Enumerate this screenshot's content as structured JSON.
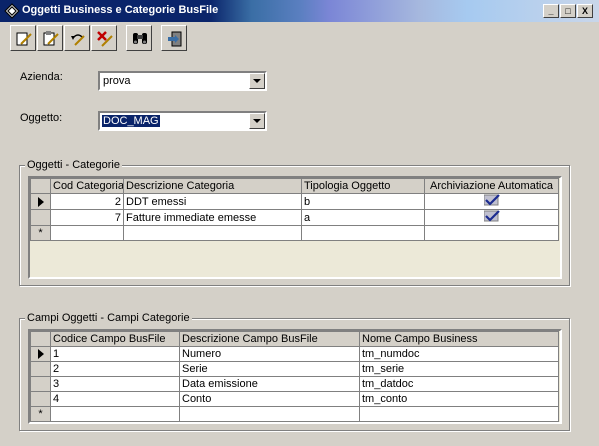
{
  "window": {
    "title": "Oggetti Business e Categorie BusFile",
    "min_label": "_",
    "max_label": "□",
    "close_label": "X"
  },
  "toolbar": {
    "buttons": [
      "new-icon",
      "edit-icon",
      "undo-icon",
      "delete-icon",
      "find-icon",
      "exit-icon"
    ]
  },
  "form": {
    "azienda_label": "Azienda:",
    "azienda_value": "prova",
    "oggetto_label": "Oggetto:",
    "oggetto_value": "DOC_MAG"
  },
  "categorie": {
    "legend": "Oggetti - Categorie",
    "columns": [
      "Cod Categoria",
      "Descrizione Categoria",
      "Tipologia Oggetto",
      "Archiviazione Automatica"
    ],
    "rows": [
      {
        "cod": "2",
        "descrizione": "DDT emessi",
        "tipologia": "b",
        "archiviazione": true
      },
      {
        "cod": "7",
        "descrizione": "Fatture immediate emesse",
        "tipologia": "a",
        "archiviazione": true
      }
    ],
    "new_row_marker": "*"
  },
  "campi": {
    "legend": "Campi Oggetti - Campi Categorie",
    "columns": [
      "Codice Campo BusFile",
      "Descrizione Campo BusFile",
      "Nome Campo Business"
    ],
    "rows": [
      {
        "codice": "1",
        "descrizione": "Numero",
        "nome": "tm_numdoc"
      },
      {
        "codice": "2",
        "descrizione": "Serie",
        "nome": "tm_serie"
      },
      {
        "codice": "3",
        "descrizione": "Data emissione",
        "nome": "tm_datdoc"
      },
      {
        "codice": "4",
        "descrizione": "Conto",
        "nome": "tm_conto"
      }
    ],
    "new_row_marker": "*"
  }
}
